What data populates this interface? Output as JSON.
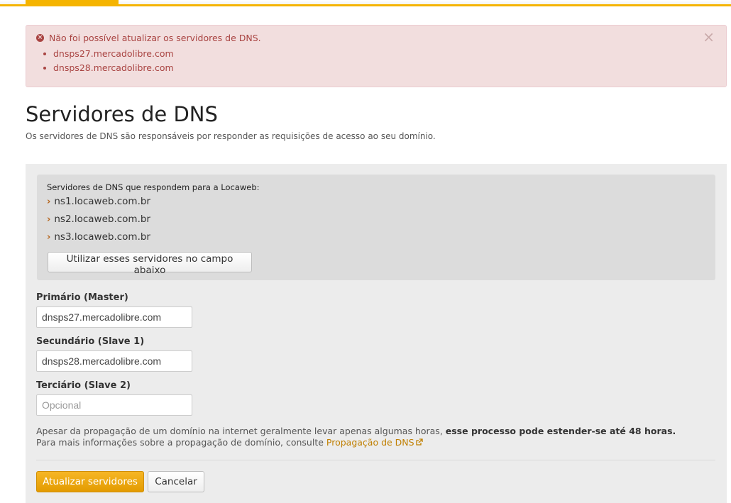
{
  "colors": {
    "accent": "#f5b400",
    "alert_bg": "#f2dede",
    "alert_text": "#a94442",
    "link": "#c07f00",
    "primary_button": "#f0a800"
  },
  "alert": {
    "icon": "error-circle-icon",
    "title": "Não foi possível atualizar os servidores de DNS.",
    "items": [
      "dnsps27.mercadolibre.com",
      "dnsps28.mercadolibre.com"
    ],
    "close": "×"
  },
  "header": {
    "title": "Servidores de DNS",
    "subtitle": "Os servidores de DNS são responsáveis por responder as requisições de acesso ao seu domínio."
  },
  "suggested": {
    "title": "Servidores de DNS que respondem para a Locaweb:",
    "servers": [
      "ns1.locaweb.com.br",
      "ns2.locaweb.com.br",
      "ns3.locaweb.com.br"
    ],
    "chevron": "›",
    "use_button": "Utilizar esses servidores no campo abaixo"
  },
  "form": {
    "primary": {
      "label": "Primário (Master)",
      "value": "dnsps27.mercadolibre.com",
      "placeholder": ""
    },
    "secondary": {
      "label": "Secundário (Slave 1)",
      "value": "dnsps28.mercadolibre.com",
      "placeholder": ""
    },
    "tertiary": {
      "label": "Terciário (Slave 2)",
      "value": "",
      "placeholder": "Opcional"
    }
  },
  "info": {
    "line1_prefix": "Apesar da propagação de um domínio na internet geralmente levar apenas algumas horas, ",
    "line1_bold": "esse processo pode estender-se até 48 horas.",
    "line2_prefix": "Para mais informações sobre a propagação de domínio, consulte ",
    "link_text": "Propagação de DNS",
    "link_icon": "external-link-icon"
  },
  "actions": {
    "submit": "Atualizar servidores",
    "cancel": "Cancelar"
  }
}
